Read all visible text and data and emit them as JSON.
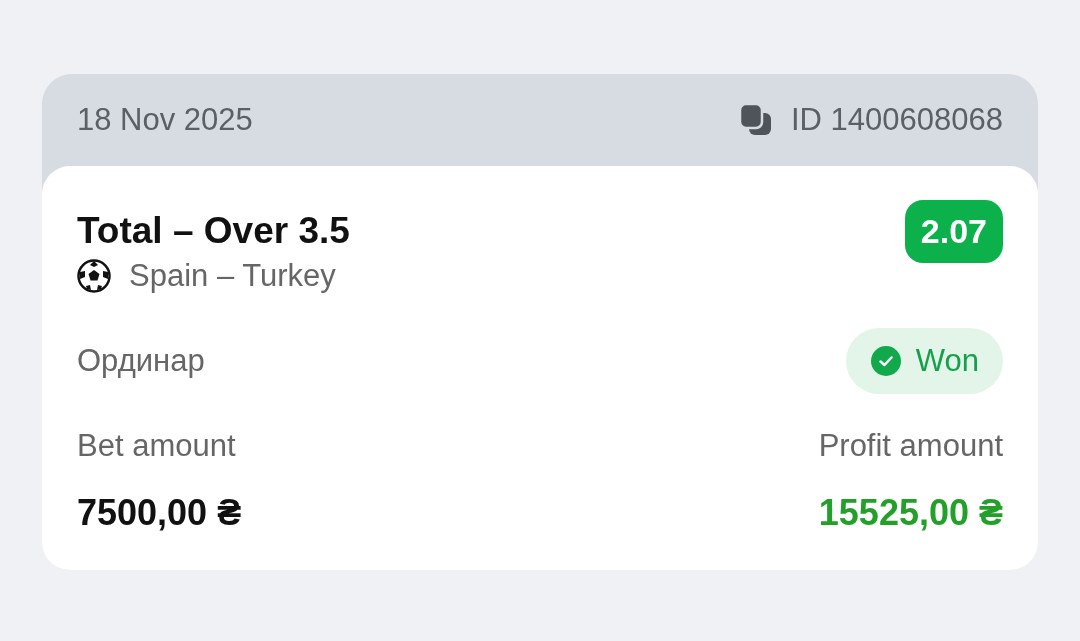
{
  "header": {
    "date": "18 Nov 2025",
    "id": "ID 1400608068"
  },
  "bet": {
    "title": "Total – Over 3.5",
    "odds": "2.07",
    "event": "Spain – Turkey",
    "type": "Ординар",
    "status": {
      "label": "Won",
      "kind": "won"
    }
  },
  "amounts": [
    {
      "label": "Bet amount",
      "value": "7500,00 ₴",
      "kind": "stake"
    },
    {
      "label": "Profit amount",
      "value": "15525,00 ₴",
      "kind": "profit"
    }
  ]
}
